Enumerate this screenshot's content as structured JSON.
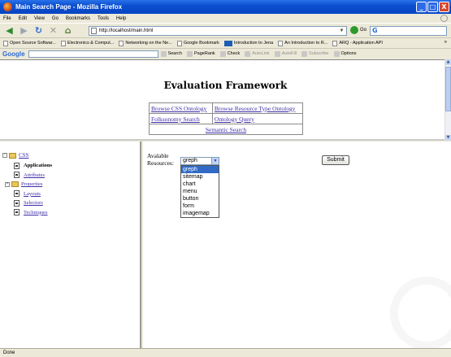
{
  "window": {
    "title": "Main Search Page - Mozilla Firefox",
    "controls": [
      "_",
      "□",
      "X"
    ]
  },
  "menu": [
    "File",
    "Edit",
    "View",
    "Go",
    "Bookmarks",
    "Tools",
    "Help"
  ],
  "nav": {
    "url": "http://localhost/main.html",
    "go_label": "Go",
    "search_logo": "G"
  },
  "bookmarks": {
    "items": [
      "Open Source Softwar...",
      "Electronics & Comput...",
      "Networking on the Ne...",
      "Google Bookmark",
      "Introduction to Jena",
      "An Introduction to R...",
      "ARQ - Application API"
    ],
    "more": "»"
  },
  "google_toolbar": {
    "logo": "Google",
    "items": [
      "Search",
      "PageRank",
      "Check",
      "AutoLink",
      "AutoFill",
      "Subscribe",
      "Options"
    ]
  },
  "page": {
    "title": "Evaluation Framework",
    "nav_links": [
      [
        "Browse CSS Ontology",
        "Browse Resource Type Ontology"
      ],
      [
        "Folksonomy Search",
        "Ontology Query"
      ]
    ],
    "semantic_search": "Semantic Search"
  },
  "tree": {
    "root": "CSS",
    "root_expander": "−",
    "items": [
      {
        "label": "Applications",
        "bold": true,
        "expander": ""
      },
      {
        "label": "Attributes",
        "bold": false,
        "expander": ""
      },
      {
        "label": "Properties",
        "bold": false,
        "expander": "+"
      },
      {
        "label": "Layouts",
        "bold": false,
        "expander": ""
      },
      {
        "label": "Selectors",
        "bold": false,
        "expander": ""
      },
      {
        "label": "Techniques",
        "bold": false,
        "expander": ""
      }
    ]
  },
  "form": {
    "label_line1": "Avalable",
    "label_line2": "Resources:",
    "selected": "greph",
    "options": [
      "greph",
      "sitemap",
      "chart",
      "menu",
      "button",
      "form",
      "imagemap"
    ],
    "submit_label": "Submit"
  },
  "status": "Done"
}
